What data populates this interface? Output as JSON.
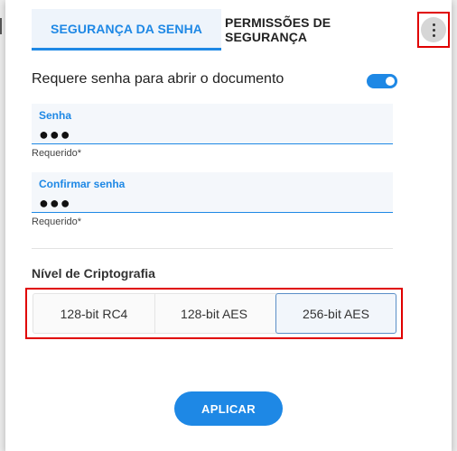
{
  "tabs": [
    {
      "label": "SEGURANÇA DA SENHA",
      "active": true
    },
    {
      "label": "PERMISSÕES DE SEGURANÇA",
      "active": false
    }
  ],
  "menu": {
    "icon": "kebab-menu-icon"
  },
  "require_password": {
    "label": "Requere senha para abrir o documento",
    "enabled": true
  },
  "password_field": {
    "label": "Senha",
    "value": "●●●",
    "helper": "Requerido*"
  },
  "confirm_field": {
    "label": "Confirmar senha",
    "value": "●●●",
    "helper": "Requerido*"
  },
  "encryption": {
    "label": "Nível de Criptografia",
    "options": [
      "128-bit RC4",
      "128-bit AES",
      "256-bit AES"
    ],
    "selected": "256-bit AES"
  },
  "apply_button": {
    "label": "APLICAR"
  },
  "colors": {
    "accent": "#1e88e5",
    "highlight_border": "#e00000"
  }
}
